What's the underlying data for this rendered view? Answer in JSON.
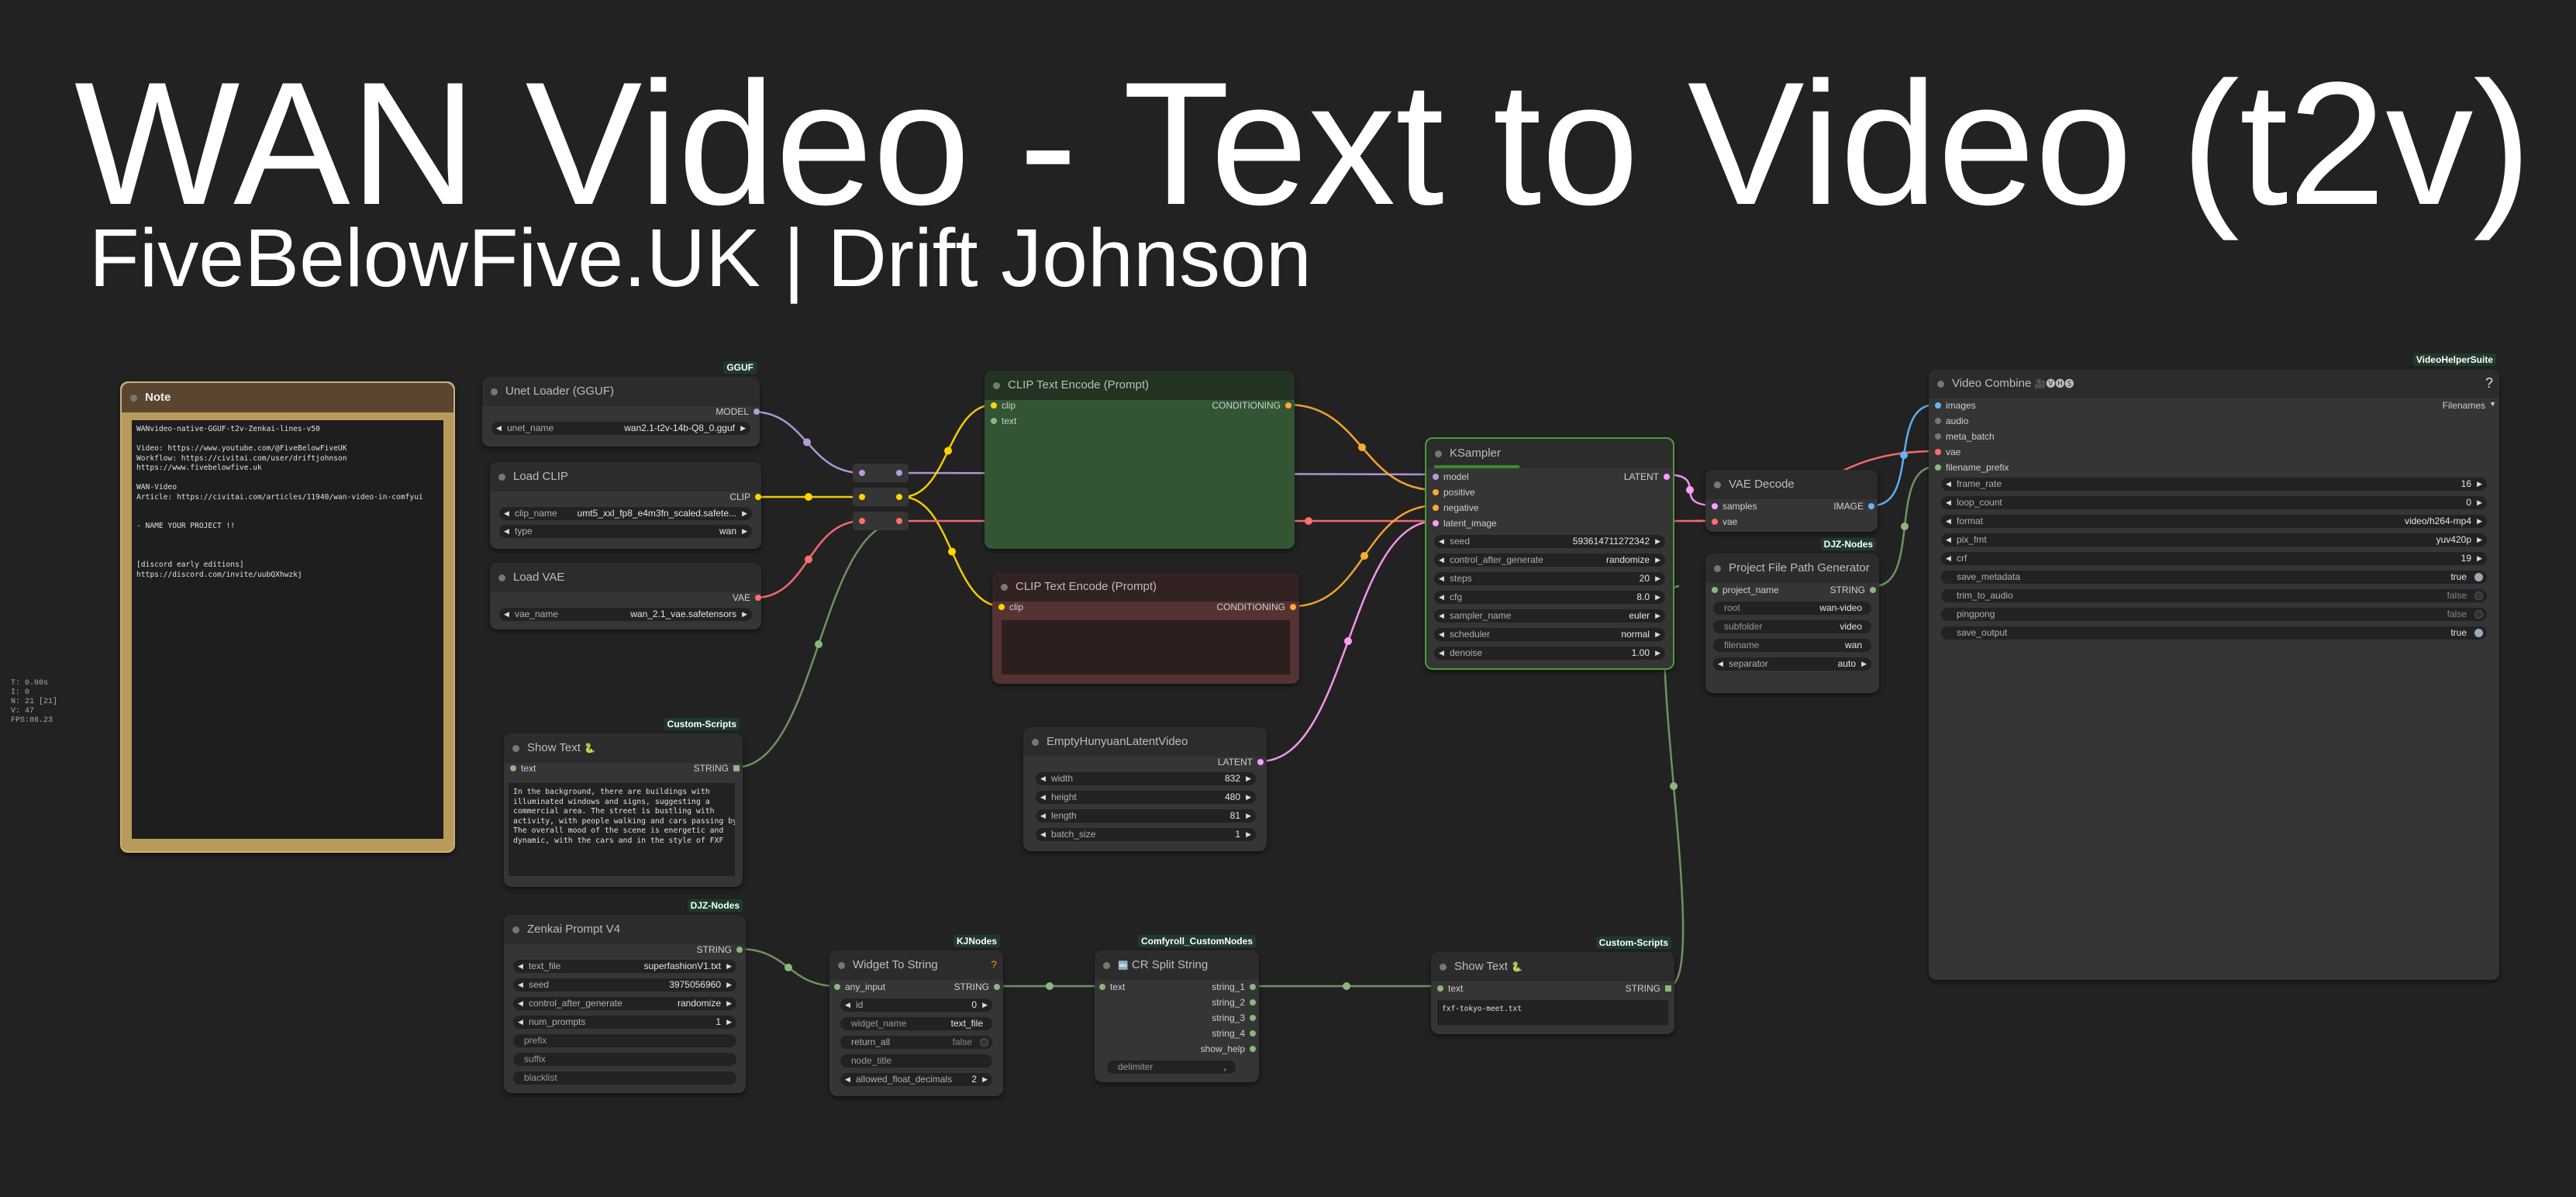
{
  "title": "WAN Video - Text to Video (t2v)",
  "subtitle": "FiveBelowFive.UK | Drift Johnson",
  "stats": [
    "T: 0.00s",
    "I: 0",
    "N: 21 [21]",
    "V: 47",
    "FPS:86.23"
  ],
  "note": {
    "title": "Note",
    "text": "WANvideo-native-GGUF-t2v-Zenkai-lines-v50\n\nVideo: https://www.youtube.com/@FiveBelowFiveUK\nWorkflow: https://civitai.com/user/driftjohnson\nhttps://www.fivebelowfive.uk\n\nWAN-Video\nArticle: https://civitai.com/articles/11940/wan-video-in-comfyui\n\n\n- NAME YOUR PROJECT !!\n\n\n\n[discord early editions]\nhttps://discord.com/invite/uubQXhwzkj"
  },
  "unet": {
    "badge": "GGUF",
    "title": "Unet Loader (GGUF)",
    "out": "MODEL",
    "w_label": "unet_name",
    "w_value": "wan2.1-t2v-14b-Q8_0.gguf"
  },
  "clip": {
    "title": "Load CLIP",
    "out": "CLIP",
    "w1_label": "clip_name",
    "w1_value": "umt5_xxl_fp8_e4m3fn_scaled.safete...",
    "w2_label": "type",
    "w2_value": "wan"
  },
  "vae": {
    "title": "Load VAE",
    "out": "VAE",
    "w_label": "vae_name",
    "w_value": "wan_2.1_vae.safetensors"
  },
  "clip_pos": {
    "title": "CLIP Text Encode (Prompt)",
    "in1": "clip",
    "in2": "text",
    "out": "CONDITIONING"
  },
  "clip_neg": {
    "title": "CLIP Text Encode (Prompt)",
    "in1": "clip",
    "out": "CONDITIONING"
  },
  "ksampler": {
    "title": "KSampler",
    "inputs": [
      "model",
      "positive",
      "negative",
      "latent_image"
    ],
    "out": "LATENT",
    "widgets": [
      {
        "l": "seed",
        "v": "593614711272342"
      },
      {
        "l": "control_after_generate",
        "v": "randomize"
      },
      {
        "l": "steps",
        "v": "20"
      },
      {
        "l": "cfg",
        "v": "8.0"
      },
      {
        "l": "sampler_name",
        "v": "euler"
      },
      {
        "l": "scheduler",
        "v": "normal"
      },
      {
        "l": "denoise",
        "v": "1.00"
      }
    ]
  },
  "vaedec": {
    "title": "VAE Decode",
    "in1": "samples",
    "in2": "vae",
    "out": "IMAGE"
  },
  "pfpg": {
    "badge": "DJZ-Nodes",
    "title": "Project File Path Generator",
    "in": "project_name",
    "out": "STRING",
    "widgets": [
      {
        "l": "root",
        "v": "wan-video"
      },
      {
        "l": "subfolder",
        "v": "video"
      },
      {
        "l": "filename",
        "v": "wan"
      },
      {
        "l": "separator",
        "v": "auto"
      }
    ]
  },
  "vcombine": {
    "badge": "VideoHelperSuite",
    "title": "Video Combine",
    "title_icons": "🎥🅥🅗🅢",
    "help": "?",
    "inputs": [
      "images",
      "audio",
      "meta_batch",
      "vae",
      "filename_prefix"
    ],
    "format_label": "Filenames",
    "widgets": [
      {
        "l": "frame_rate",
        "v": "16"
      },
      {
        "l": "loop_count",
        "v": "0"
      },
      {
        "l": "format",
        "v": "video/h264-mp4"
      },
      {
        "l": "pix_fmt",
        "v": "yuv420p"
      },
      {
        "l": "crf",
        "v": "19"
      }
    ],
    "toggles": [
      {
        "l": "save_metadata",
        "v": "true"
      },
      {
        "l": "trim_to_audio",
        "v": "false"
      },
      {
        "l": "pingpong",
        "v": "false"
      },
      {
        "l": "save_output",
        "v": "true"
      }
    ]
  },
  "showtext1": {
    "badge": "Custom-Scripts",
    "title": "Show Text",
    "icon": "🐍",
    "in": "text",
    "out": "STRING",
    "text": "In the background, there are buildings with\nilluminated windows and signs, suggesting a\ncommercial area. The street is bustling with\nactivity, with people walking and cars passing by.\nThe overall mood of the scene is energetic and\ndynamic, with the cars and in the style of FXF"
  },
  "latent": {
    "title": "EmptyHunyuanLatentVideo",
    "out": "LATENT",
    "widgets": [
      {
        "l": "width",
        "v": "832"
      },
      {
        "l": "height",
        "v": "480"
      },
      {
        "l": "length",
        "v": "81"
      },
      {
        "l": "batch_size",
        "v": "1"
      }
    ]
  },
  "zenkai": {
    "badge": "DJZ-Nodes",
    "title": "Zenkai Prompt V4",
    "out": "STRING",
    "widgets": [
      {
        "l": "text_file",
        "v": "superfashionV1.txt"
      },
      {
        "l": "seed",
        "v": "3975056960"
      },
      {
        "l": "control_after_generate",
        "v": "randomize"
      },
      {
        "l": "num_prompts",
        "v": "1"
      }
    ],
    "texts": [
      "prefix",
      "suffix",
      "blacklist"
    ]
  },
  "w2s": {
    "badge": "KJNodes",
    "title": "Widget To String",
    "help": "?",
    "in": "any_input",
    "out": "STRING",
    "widgets": [
      {
        "l": "id",
        "v": "0",
        "t": "num"
      },
      {
        "l": "widget_name",
        "v": "text_file",
        "t": "txt"
      },
      {
        "l": "return_all",
        "v": "false",
        "t": "tg"
      },
      {
        "l": "node_title",
        "v": "",
        "t": "txt"
      },
      {
        "l": "allowed_float_decimals",
        "v": "2",
        "t": "num"
      }
    ]
  },
  "split": {
    "badge": "Comfyroll_CustomNodes",
    "title": "CR Split String",
    "icon": "🔤",
    "in": "text",
    "outs": [
      "string_1",
      "string_2",
      "string_3",
      "string_4",
      "show_help"
    ],
    "w_label": "delimiter",
    "w_value": ","
  },
  "showtext2": {
    "badge": "Custom-Scripts",
    "title": "Show Text",
    "icon": "🐍",
    "in": "text",
    "out": "STRING",
    "text": "fxf-tokyo-meet.txt"
  },
  "colors": {
    "model": "#b39ddb",
    "clip": "#ffd500",
    "vae": "#ff6e6e",
    "conditioning": "#ffa931",
    "latent": "#ff9cf9",
    "image": "#64b5f6",
    "string": "#8ab87a"
  }
}
